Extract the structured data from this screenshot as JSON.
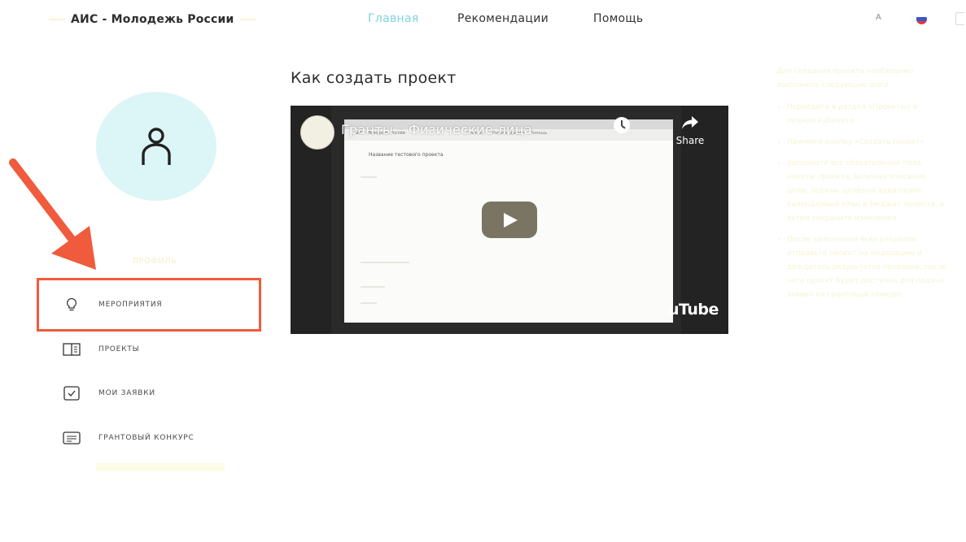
{
  "header": {
    "logo": "АИС - Молодежь России",
    "nav": [
      {
        "label": "Главная",
        "active": true
      },
      {
        "label": "Рекомендации",
        "active": false
      },
      {
        "label": "Помощь",
        "active": false
      }
    ],
    "lang": "A",
    "flag_colors": [
      "#ffffff",
      "#3c56c4",
      "#e03a3a"
    ]
  },
  "sidebar": {
    "profile_label": "ПРОФИЛЬ",
    "items": [
      {
        "label": "МЕРОПРИЯТИЯ",
        "icon": "lightbulb-icon",
        "highlighted": true
      },
      {
        "label": "ПРОЕКТЫ",
        "icon": "book-icon"
      },
      {
        "label": "МОИ ЗАЯВКИ",
        "icon": "checkbox-icon"
      },
      {
        "label": "ГРАНТОВЫЙ КОНКУРС",
        "icon": "certificate-icon"
      }
    ]
  },
  "main": {
    "title": "Как создать проект",
    "video": {
      "title": "Гранты – Физические лица",
      "share_label": "Share",
      "brand": "uTube",
      "inner_page": {
        "logo": "АИС - Молодежь России",
        "nav": [
          "Главная",
          "Рекомендации",
          "Помощь"
        ],
        "heading": "Название тестового проекта"
      }
    }
  },
  "right_column": {
    "intro": "Для создания проекта необходимо выполнить следующие шаги",
    "items": [
      "Перейдите в раздел «Проекты» в личном кабинете",
      "Нажмите кнопку «Создать проект»",
      "Заполните все обязательные поля анкеты проекта, включая описание, цели, задачи, целевую аудиторию, календарный план и бюджет проекта, а затем сохраните изменения",
      "После заполнения всех разделов отправьте проект на модерацию и дождитесь результатов проверки, после чего проект будет доступен для подачи заявки на грантовый конкурс"
    ]
  },
  "colors": {
    "accent": "#7fd3da",
    "annotation": "#ef5b3c",
    "avatar_bg": "#dcf5f6"
  }
}
